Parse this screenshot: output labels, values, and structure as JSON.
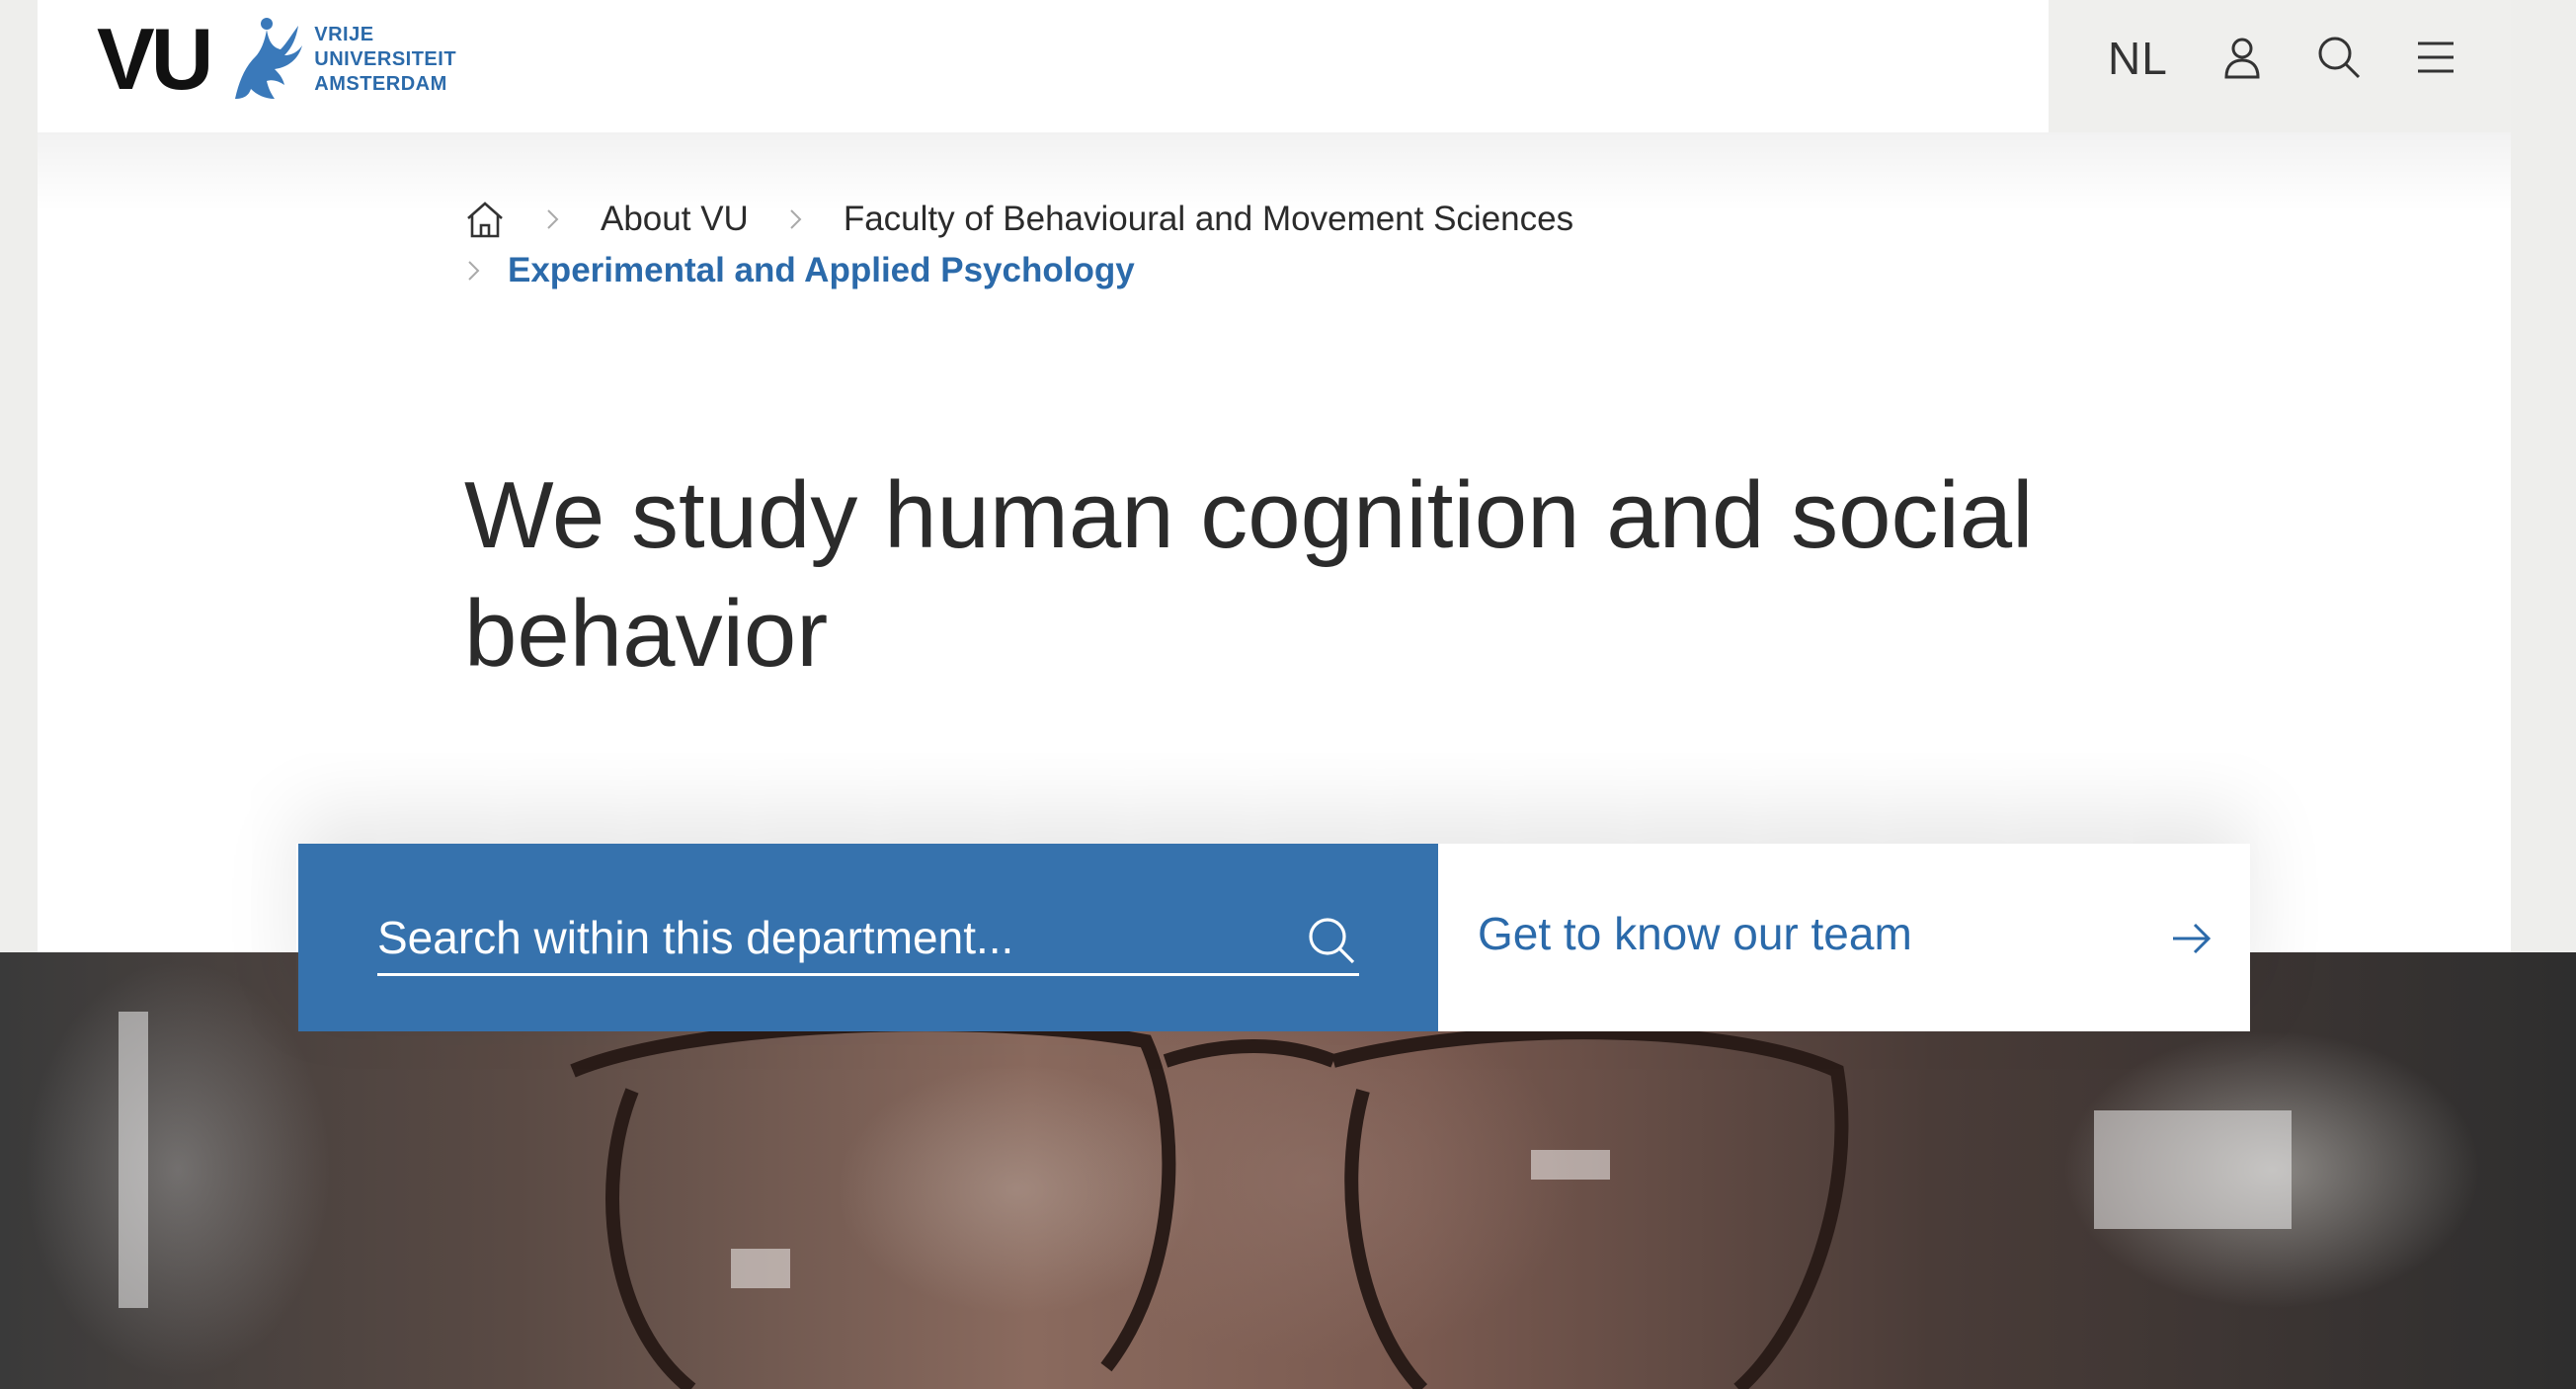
{
  "header": {
    "logo": {
      "short": "VU",
      "line1": "VRIJE",
      "line2": "UNIVERSITEIT",
      "line3": "AMSTERDAM"
    },
    "language_label": "NL",
    "icons": [
      "user-icon",
      "search-icon",
      "menu-icon"
    ]
  },
  "breadcrumb": {
    "home_icon": "home-icon",
    "items": [
      {
        "label": "About VU"
      },
      {
        "label": "Faculty of Behavioural and Movement Sciences"
      },
      {
        "label": "Experimental and Applied Psychology"
      }
    ]
  },
  "hero": {
    "title": "We study human cognition and social behavior"
  },
  "search": {
    "placeholder": "Search within this department...",
    "value": ""
  },
  "team_link": {
    "label": "Get to know our team"
  },
  "colors": {
    "brand_blue": "#3672ad",
    "link_blue": "#2b6aaa"
  }
}
